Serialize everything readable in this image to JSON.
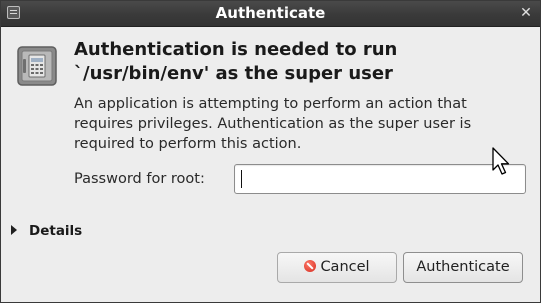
{
  "window": {
    "title": "Authenticate",
    "close_glyph": "✕"
  },
  "dialog": {
    "icon": "safe-lock-icon",
    "heading": "Authentication is needed to run `/usr/bin/env' as the super user",
    "message": "An application is attempting to perform an action that requires privileges. Authentication as the super user is required to perform this action.",
    "password_label": "Password for root:",
    "password_value": "",
    "details_label": "Details"
  },
  "buttons": {
    "cancel_label": "Cancel",
    "authenticate_label": "Authenticate"
  },
  "colors": {
    "titlebar": "#3a3a3a",
    "dialog_bg": "#ededed",
    "cancel_icon": "#d42a1e"
  }
}
